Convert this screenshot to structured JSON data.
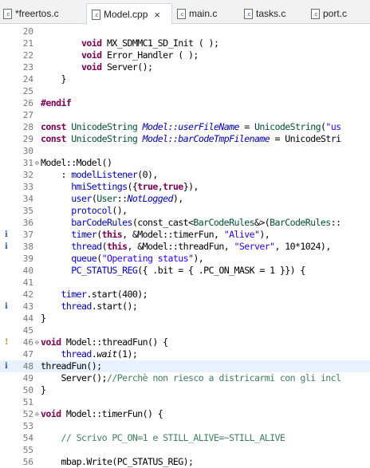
{
  "tabs": [
    {
      "label": "*freertos.c",
      "active": false,
      "closable": false
    },
    {
      "label": "Model.cpp",
      "active": true,
      "closable": true
    },
    {
      "label": "main.c",
      "active": false,
      "closable": false
    },
    {
      "label": "tasks.c",
      "active": false,
      "closable": false
    },
    {
      "label": "port.c",
      "active": false,
      "closable": false
    }
  ],
  "close_glyph": "×",
  "file_icon_glyph": ".c",
  "colors": {
    "keyword": "#7f0055",
    "string": "#2a00ff",
    "comment": "#3f7f5f",
    "italic_member": "#0000c0",
    "type_blue": "#005032",
    "highlight": "#e8f2fe"
  },
  "lines": [
    {
      "n": "20",
      "t": ""
    },
    {
      "n": "21",
      "t": "        void MX_SDMMC1_SD_Init ( );"
    },
    {
      "n": "22",
      "t": "        void Error_Handler ( );"
    },
    {
      "n": "23",
      "t": "        void Server();"
    },
    {
      "n": "24",
      "t": "    }"
    },
    {
      "n": "25",
      "t": ""
    },
    {
      "n": "26",
      "t": "#endif"
    },
    {
      "n": "27",
      "t": ""
    },
    {
      "n": "28",
      "t": "const UnicodeString Model::userFileName = UnicodeString(\"us"
    },
    {
      "n": "29",
      "t": "const UnicodeString Model::barCodeTmpFilename = UnicodeStri"
    },
    {
      "n": "30",
      "t": ""
    },
    {
      "n": "31",
      "t": "Model::Model()",
      "fold": "⊖"
    },
    {
      "n": "32",
      "t": "    : modelListener(0),"
    },
    {
      "n": "33",
      "t": "      hmiSettings({true,true}),"
    },
    {
      "n": "34",
      "t": "      user(User::NotLogged),"
    },
    {
      "n": "35",
      "t": "      protocol(),"
    },
    {
      "n": "36",
      "t": "      barCodeRules(const_cast<BarCodeRules&>(BarCodeRules::"
    },
    {
      "n": "37",
      "t": "      timer(this, &Model::timerFun, \"Alive\"),",
      "mark": "i"
    },
    {
      "n": "38",
      "t": "      thread(this, &Model::threadFun, \"Server\", 10*1024),",
      "mark": "i"
    },
    {
      "n": "39",
      "t": "      queue(\"Operating status\"),"
    },
    {
      "n": "40",
      "t": "      PC_STATUS_REG({ .bit = { .PC_ON_MASK = 1 }}) {"
    },
    {
      "n": "41",
      "t": ""
    },
    {
      "n": "42",
      "t": "    timer.start(400);"
    },
    {
      "n": "43",
      "t": "    thread.start();",
      "mark": "i"
    },
    {
      "n": "44",
      "t": "}"
    },
    {
      "n": "45",
      "t": ""
    },
    {
      "n": "46",
      "t": "void Model::threadFun() {",
      "fold": "⊖",
      "mark": "!"
    },
    {
      "n": "47",
      "t": "    thread.wait(1);"
    },
    {
      "n": "48",
      "t": "threadFun();",
      "mark": "i",
      "highlight": true
    },
    {
      "n": "49",
      "t": "    Server();//Perchè non riesco a districarmi con gli incl"
    },
    {
      "n": "50",
      "t": "}"
    },
    {
      "n": "51",
      "t": ""
    },
    {
      "n": "52",
      "t": "void Model::timerFun() {",
      "fold": "⊖"
    },
    {
      "n": "53",
      "t": ""
    },
    {
      "n": "54",
      "t": "    // Scrivo PC_ON=1 e STILL_ALIVE=~STILL_ALIVE"
    },
    {
      "n": "55",
      "t": ""
    },
    {
      "n": "56",
      "t": "    mbap.Write(PC_STATUS_REG);"
    }
  ]
}
